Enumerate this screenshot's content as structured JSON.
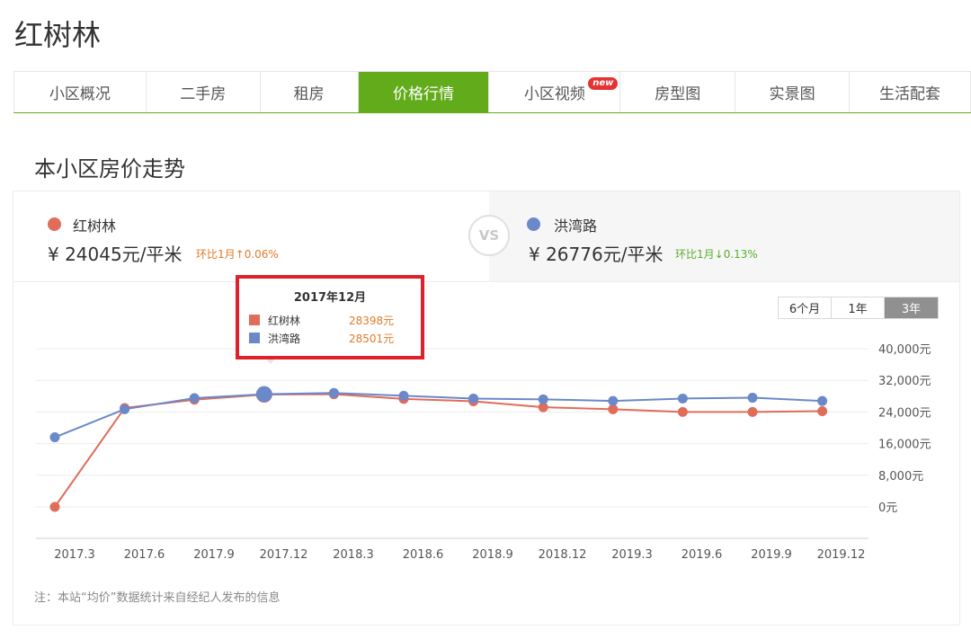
{
  "page": {
    "title": "红树林"
  },
  "tabs": [
    {
      "label": "小区概况"
    },
    {
      "label": "二手房"
    },
    {
      "label": "租房"
    },
    {
      "label": "价格行情",
      "active": true
    },
    {
      "label": "小区视频",
      "badge": "new"
    },
    {
      "label": "房型图"
    },
    {
      "label": "实景图"
    },
    {
      "label": "生活配套"
    }
  ],
  "section": {
    "title": "本小区房价走势"
  },
  "compare": {
    "left": {
      "name": "红树林",
      "price": "¥ 24045元/平米",
      "change": "环比1月↑0.06%",
      "color": "#e06c5a",
      "change_color": "#e07b2a"
    },
    "vs": "VS",
    "right": {
      "name": "洪湾路",
      "price": "¥ 26776元/平米",
      "change": "环比1月↓0.13%",
      "color": "#6b88c8",
      "change_color": "#5aae2e"
    }
  },
  "range_buttons": [
    {
      "label": "6个月"
    },
    {
      "label": "1年"
    },
    {
      "label": "3年",
      "active": true
    }
  ],
  "tooltip": {
    "title": "2017年12月",
    "rows": [
      {
        "name": "红树林",
        "value": "28398元",
        "color": "#e06c5a"
      },
      {
        "name": "洪湾路",
        "value": "28501元",
        "color": "#6b88c8"
      }
    ]
  },
  "chart_data": {
    "type": "line",
    "x": [
      "2017.3",
      "2017.6",
      "2017.9",
      "2017.12",
      "2018.3",
      "2018.6",
      "2018.9",
      "2018.12",
      "2019.3",
      "2019.6",
      "2019.9",
      "2019.12"
    ],
    "y_ticks": [
      "40,000元",
      "32,000元",
      "24,000元",
      "16,000元",
      "8,000元",
      "0元"
    ],
    "ylim": [
      0,
      40000
    ],
    "series": [
      {
        "name": "红树林",
        "color": "#e06c5a",
        "values": [
          0,
          25000,
          27100,
          28398,
          28500,
          27300,
          26700,
          25200,
          24700,
          24000,
          24000,
          24200
        ]
      },
      {
        "name": "洪湾路",
        "color": "#6b88c8",
        "values": [
          17600,
          24700,
          27500,
          28501,
          28800,
          28100,
          27400,
          27200,
          26800,
          27400,
          27600,
          26776
        ]
      }
    ],
    "highlight_index": 3,
    "grid": true
  },
  "footer": {
    "note": "注：本站“均价”数据统计来自经纪人发布的信息"
  }
}
